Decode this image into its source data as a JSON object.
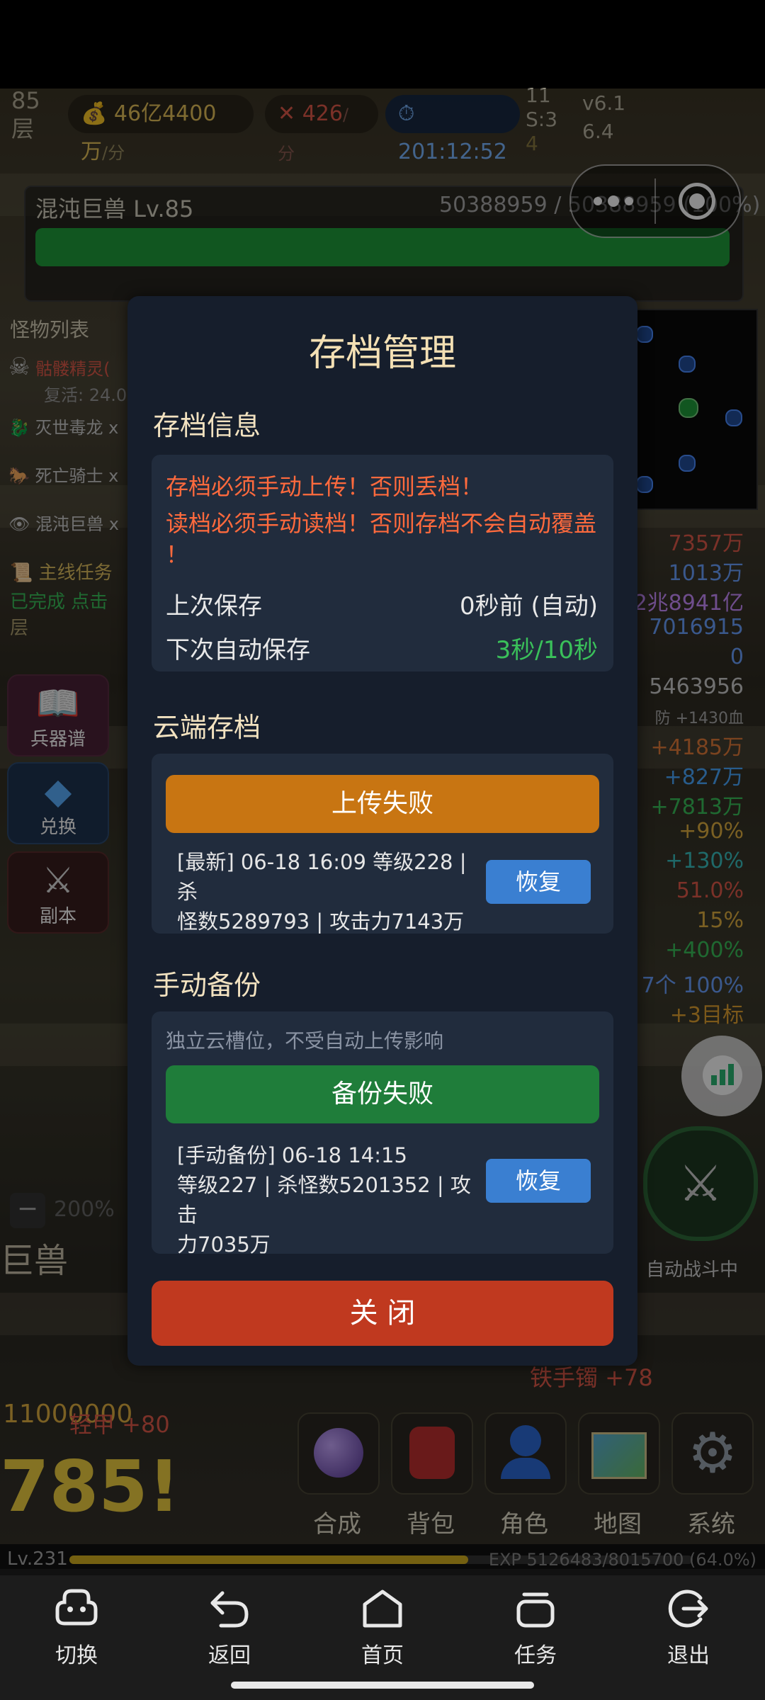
{
  "hud": {
    "floor_num": "85",
    "floor_unit": "层",
    "gold": "46亿4400万",
    "gold_unit": "/分",
    "attack": "426",
    "attack_unit": "/分",
    "timer": "201:12:52",
    "s_line1": "11",
    "s_line2": "S:3",
    "s_line3": "4",
    "version_line1": "v6.1",
    "version_line2": "6.4"
  },
  "boss": {
    "name": "混沌巨兽 Lv.85",
    "hp_text": "50388959 / 50388959 (100%)",
    "hp_fraction": 1.0
  },
  "left_panel": {
    "title": "怪物列表",
    "monsters": [
      {
        "name": "骷髅精灵(",
        "sub": "复活: 24.0"
      },
      {
        "name": "灭世毒龙 x"
      },
      {
        "name": "死亡骑士 x"
      },
      {
        "name": "混沌巨兽 x"
      }
    ],
    "quest_title": "主线任务",
    "quest_line1": "已完成 点击",
    "quest_line2": "层",
    "buttons": [
      {
        "label": "兵器谱"
      },
      {
        "label": "兑换"
      },
      {
        "label": "副本"
      }
    ],
    "zoom": "200%",
    "boss_label": "巨兽",
    "damage_text": "11000000",
    "crit_text": "785!"
  },
  "right_stats": [
    {
      "text": "7357万",
      "color": "#e05a4a"
    },
    {
      "text": "1013万",
      "color": "#6aa0ff"
    },
    {
      "text": "2兆8941亿",
      "color": "#c98cff"
    },
    {
      "text": "7016915",
      "color": "#6aa0ff"
    },
    {
      "text": "0",
      "color": "#6aa0ff"
    },
    {
      "text": "5463956",
      "color": "#cccccc"
    },
    {
      "text": "防 +1430血",
      "color": "#aaaaaa"
    },
    {
      "text": "+4185万",
      "color": "#e07a3a"
    },
    {
      "text": "+827万",
      "color": "#4aa8ff"
    },
    {
      "text": "+7813万",
      "color": "#3ac05a"
    },
    {
      "text": "+90%",
      "color": "#e0b040"
    },
    {
      "text": "+130%",
      "color": "#3ac0c0"
    },
    {
      "text": "51.0%",
      "color": "#e05a4a"
    },
    {
      "text": "15%",
      "color": "#e0b040"
    },
    {
      "text": "+400%",
      "color": "#3ac05a"
    },
    {
      "text": "7个 100%",
      "color": "#6aa0ff"
    },
    {
      "text": "+3目标",
      "color": "#e0a030"
    }
  ],
  "auto_battle": "自动战斗中",
  "floating_texts": {
    "iron_hand": "铁手镯 +78",
    "light_armor": "轻甲 +80"
  },
  "modal": {
    "title": "存档管理",
    "section_info": "存档信息",
    "warning1": "存档必须手动上传！否则丢档！",
    "warning2": "读档必须手动读档！否则存档不会自动覆盖",
    "warning3": "！",
    "last_save_label": "上次保存",
    "last_save_value": "0秒前 (自动)",
    "next_save_label": "下次自动保存",
    "next_save_value": "3秒/10秒",
    "section_cloud": "云端存档",
    "upload_button": "上传失败",
    "cloud_info_line1": "[最新] 06-18 16:09 等级228 | 杀",
    "cloud_info_line2": "怪数5289793 | 攻击力7143万",
    "restore_label": "恢复",
    "section_backup": "手动备份",
    "backup_hint": "独立云槽位，不受自动上传影响",
    "backup_button": "备份失败",
    "backup_info_line1": "[手动备份] 06-18 14:15",
    "backup_info_line2": "等级227 | 杀怪数5201352 | 攻击",
    "backup_info_line3": "力7035万",
    "close_button": "关 闭"
  },
  "game_menu": [
    {
      "label": "合成"
    },
    {
      "label": "背包"
    },
    {
      "label": "角色"
    },
    {
      "label": "地图"
    },
    {
      "label": "系统"
    }
  ],
  "exp_bar": {
    "level": "Lv.231",
    "text": "EXP 5126483/8015700 (64.0%)",
    "fraction": 0.64
  },
  "system_nav": [
    {
      "label": "切换"
    },
    {
      "label": "返回"
    },
    {
      "label": "首页"
    },
    {
      "label": "任务"
    },
    {
      "label": "退出"
    }
  ]
}
